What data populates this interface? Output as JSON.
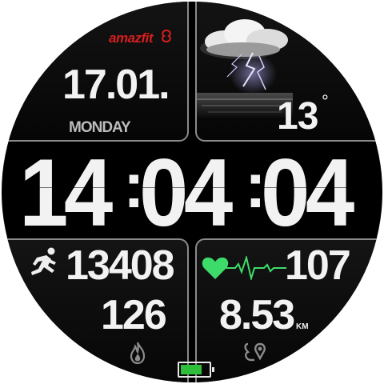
{
  "brand": {
    "name": "amazfit"
  },
  "date": {
    "day_month": "17.01.",
    "weekday": "MONDAY"
  },
  "weather": {
    "temperature": "13",
    "degree_symbol": "°",
    "condition_icon": "thunderstorm-icon"
  },
  "time": {
    "hh": "14",
    "mm": "04",
    "ss": "04",
    "separator": ":"
  },
  "activity": {
    "steps": "13408",
    "calories": "126",
    "distance": "8.53",
    "distance_unit": "KM"
  },
  "health": {
    "heart_rate": "107"
  },
  "battery": {
    "level": 0.75
  },
  "colors": {
    "brand_red": "#d71e1e",
    "heart_green": "#3ddc6a",
    "battery_green": "#2fbf3a",
    "text": "#f2f2f2",
    "frame": "#8a8a8a"
  },
  "icons": [
    "amazfit-logo-icon",
    "thunderstorm-icon",
    "running-man-icon",
    "heart-icon",
    "ecg-line-icon",
    "flame-icon",
    "route-pin-icon",
    "battery-icon"
  ]
}
